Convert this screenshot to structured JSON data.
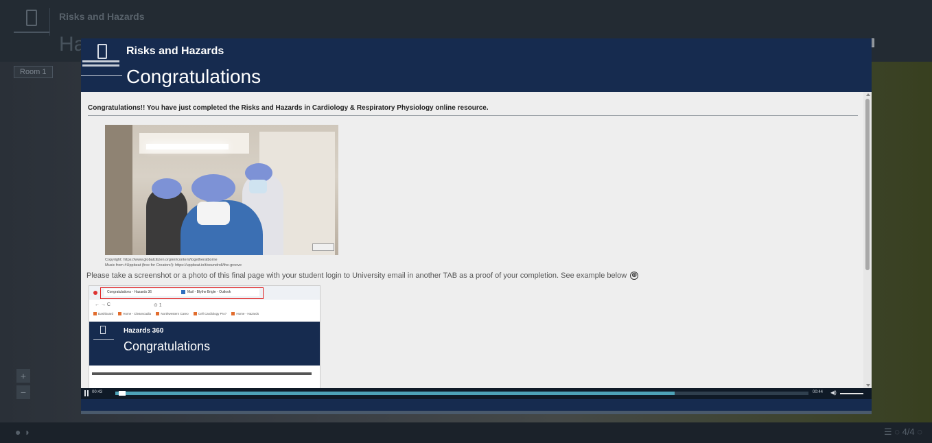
{
  "background": {
    "app_title": "Risks and Hazards",
    "heading_fragment": "Ha",
    "room_label": "Room 1",
    "zoom_in": "+",
    "zoom_out": "−",
    "bottom_left": "● ◑",
    "bottom_right": "☰  ◌  4/4  ◌"
  },
  "modal": {
    "site_name": "Risks and Hazards",
    "title": "Congratulations",
    "close_icon": "close-icon"
  },
  "content": {
    "congrats_text": "Congratulations!! You have just completed the Risks and Hazards in Cardiology & Respiratory Physiology online resource.",
    "photo_credit_1": "Copyright: https://www.globalcitizen.org/en/content/togetheratborne",
    "photo_credit_2": "Music from #Uppbeat (free for Creators!): https://uppbeat.io/t/soundroll/the-groove",
    "instruction": "Please take a screenshot or a photo of this final page with your student login to University email in another TAB as a proof of your completion. See example below",
    "plus_icon": "⊕"
  },
  "example": {
    "tab1": "Congratulations - Hazards 36",
    "tab2": "Mail - Blythe Brigle - Outlook",
    "nav": "←  →  C",
    "url": "⊙ 1",
    "bookmarks": [
      "Dashboard",
      "Home - Cleanscadia",
      "Northwestern Careo",
      "Cell Cardiology Pro?",
      "Home - Hazards"
    ],
    "site_name": "Hazards 360",
    "title": "Congratulations"
  },
  "player": {
    "current_time": "00:43",
    "total_time": "00:44",
    "progress": 0.807,
    "volume_icon": "◀)"
  },
  "colors": {
    "header_navy": "#162b4f",
    "progress": "#4ea3b8",
    "highlight_red": "#e02020"
  }
}
